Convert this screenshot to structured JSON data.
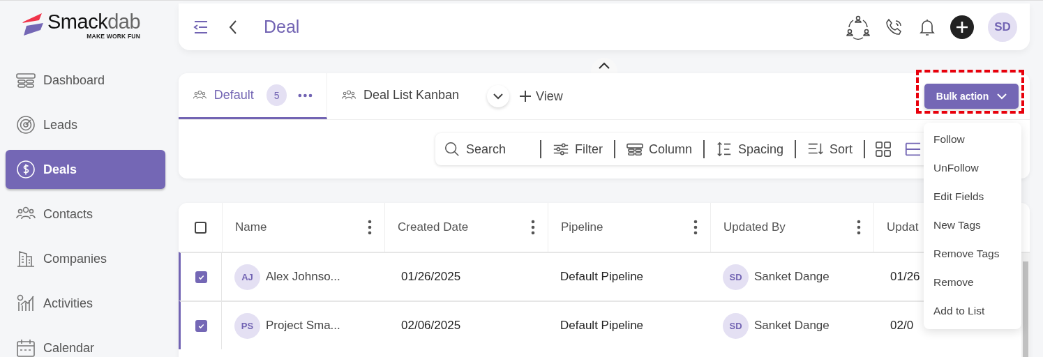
{
  "logo": {
    "name": "Smack",
    "name_accent": "dab",
    "tagline": "MAKE WORK FUN"
  },
  "sidebar": {
    "items": [
      {
        "kind": "dashboard",
        "label": "Dashboard",
        "selected": false
      },
      {
        "kind": "leads",
        "label": "Leads",
        "selected": false
      },
      {
        "kind": "deals",
        "label": "Deals",
        "selected": true
      },
      {
        "kind": "contacts",
        "label": "Contacts",
        "selected": false
      },
      {
        "kind": "companies",
        "label": "Companies",
        "selected": false
      },
      {
        "kind": "activities",
        "label": "Activities",
        "selected": false
      },
      {
        "kind": "calendar",
        "label": "Calendar",
        "selected": false
      }
    ]
  },
  "header": {
    "title": "Deal",
    "user_initials": "SD"
  },
  "tabs": [
    {
      "label": "Default",
      "count": "5",
      "selected": true
    },
    {
      "label": "Deal List Kanban",
      "selected": false
    }
  ],
  "add_view": "View",
  "bulk_action": {
    "label": "Bulk action",
    "highlighted": true
  },
  "toolbar": [
    {
      "kind": "search",
      "label": "Search"
    },
    {
      "kind": "filter",
      "label": "Filter"
    },
    {
      "kind": "column",
      "label": "Column"
    },
    {
      "kind": "spacing",
      "label": "Spacing"
    },
    {
      "kind": "sort",
      "label": "Sort"
    }
  ],
  "view_modes": [
    {
      "kind": "grid",
      "selected": false
    },
    {
      "kind": "list",
      "selected": true
    }
  ],
  "table": {
    "select_all_checked": false,
    "columns": [
      {
        "label": "Name",
        "menu_icon": true
      },
      {
        "label": "Created Date",
        "menu_icon": true
      },
      {
        "label": "Pipeline",
        "menu_icon": true
      },
      {
        "label": "Updated By",
        "menu_icon": true
      },
      {
        "label": "Updat",
        "menu_icon": false
      }
    ],
    "rows": [
      {
        "selected": true,
        "initials": "AJ",
        "name": "Alex Johnso...",
        "created_date": "01/26/2025",
        "pipeline": "Default Pipeline",
        "updated_by_initials": "SD",
        "updated_by": "Sanket Dange",
        "column_6": "01/26"
      },
      {
        "selected": true,
        "initials": "PS",
        "name": "Project Sma...",
        "created_date": "02/06/2025",
        "pipeline": "Default Pipeline",
        "updated_by_initials": "SD",
        "updated_by": "Sanket Dange",
        "column_6": "02/0"
      }
    ]
  },
  "bulk_menu": {
    "items": [
      "Follow",
      "UnFollow",
      "Edit Fields",
      "New Tags",
      "Remove Tags",
      "Remove",
      "Add to List"
    ]
  }
}
